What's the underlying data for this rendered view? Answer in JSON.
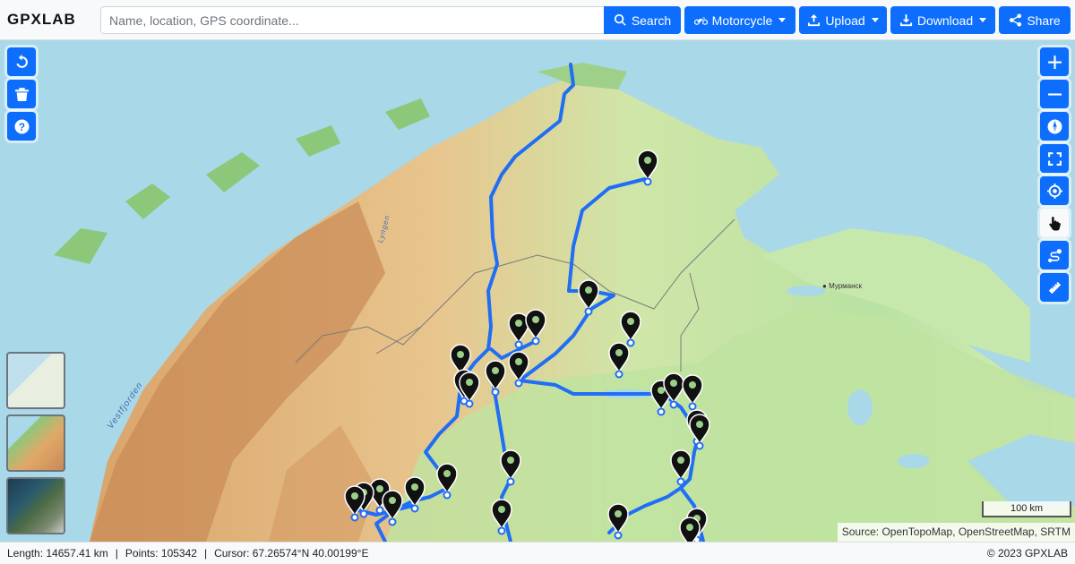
{
  "app": {
    "logo": "GPXLAB"
  },
  "search": {
    "placeholder": "Name, location, GPS coordinate...",
    "button_label": "Search"
  },
  "toolbar": {
    "vehicle_label": "Motorcycle",
    "upload_label": "Upload",
    "download_label": "Download",
    "share_label": "Share"
  },
  "left_controls": [
    "undo-icon",
    "trash-icon",
    "help-icon"
  ],
  "right_controls": [
    "plus-icon",
    "minus-icon",
    "compass-icon",
    "fullscreen-icon",
    "locate-icon",
    "hand-pointer-icon",
    "route-icon",
    "ruler-icon"
  ],
  "map": {
    "labels": {
      "city": "Мурманск",
      "fjord": "Vestfjorden",
      "river": "Lyngen"
    },
    "scale_label": "100 km",
    "attribution": "Source: OpenTopoMap, OpenStreetMap, SRTM"
  },
  "status": {
    "length": "Length: 14657.41 km",
    "points": "Points: 105342",
    "cursor": "Cursor: 67.26574°N 40.00199°E",
    "copyright": "© 2023 GPXLAB"
  },
  "colors": {
    "primary": "#0d6efd",
    "track": "#1f6ef5",
    "water": "#a9d8e8",
    "land": "#f2e2b8"
  }
}
